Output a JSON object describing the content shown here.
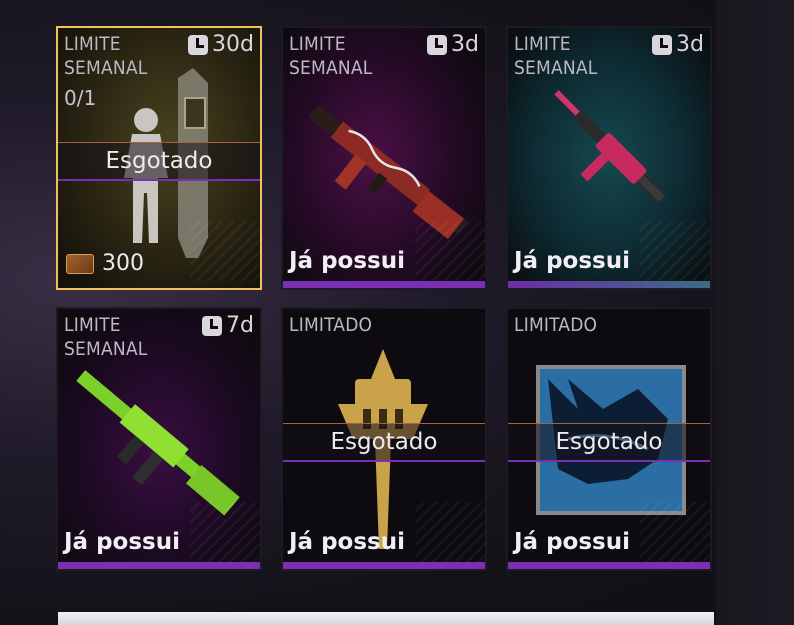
{
  "cards": [
    {
      "tag": "LIMITE\nSEMANAL",
      "timer": "30d",
      "counter": "0/1",
      "overlay": "Esgotado",
      "price": "300",
      "owned": null,
      "selected": true,
      "art_icon": "character-silhouette-icon"
    },
    {
      "tag": "LIMITE\nSEMANAL",
      "timer": "3d",
      "overlay": null,
      "owned": "Já possui",
      "art_icon": "assault-rifle-icon"
    },
    {
      "tag": "LIMITE\nSEMANAL",
      "timer": "3d",
      "overlay": null,
      "owned": "Já possui",
      "art_icon": "smg-icon"
    },
    {
      "tag": "LIMITE\nSEMANAL",
      "timer": "7d",
      "overlay": null,
      "owned": "Já possui",
      "art_icon": "green-rifle-icon"
    },
    {
      "tag": "LIMITADO",
      "timer": null,
      "overlay": "Esgotado",
      "owned": "Já possui",
      "art_icon": "golden-emblem-icon"
    },
    {
      "tag": "LIMITADO",
      "timer": null,
      "overlay": "Esgotado",
      "owned": "Já possui",
      "art_icon": "wolf-banner-icon"
    }
  ],
  "colors": {
    "selected_border": "#f1c15a",
    "bar": "#7b2fb3",
    "soldout_line": "#a8603f"
  }
}
